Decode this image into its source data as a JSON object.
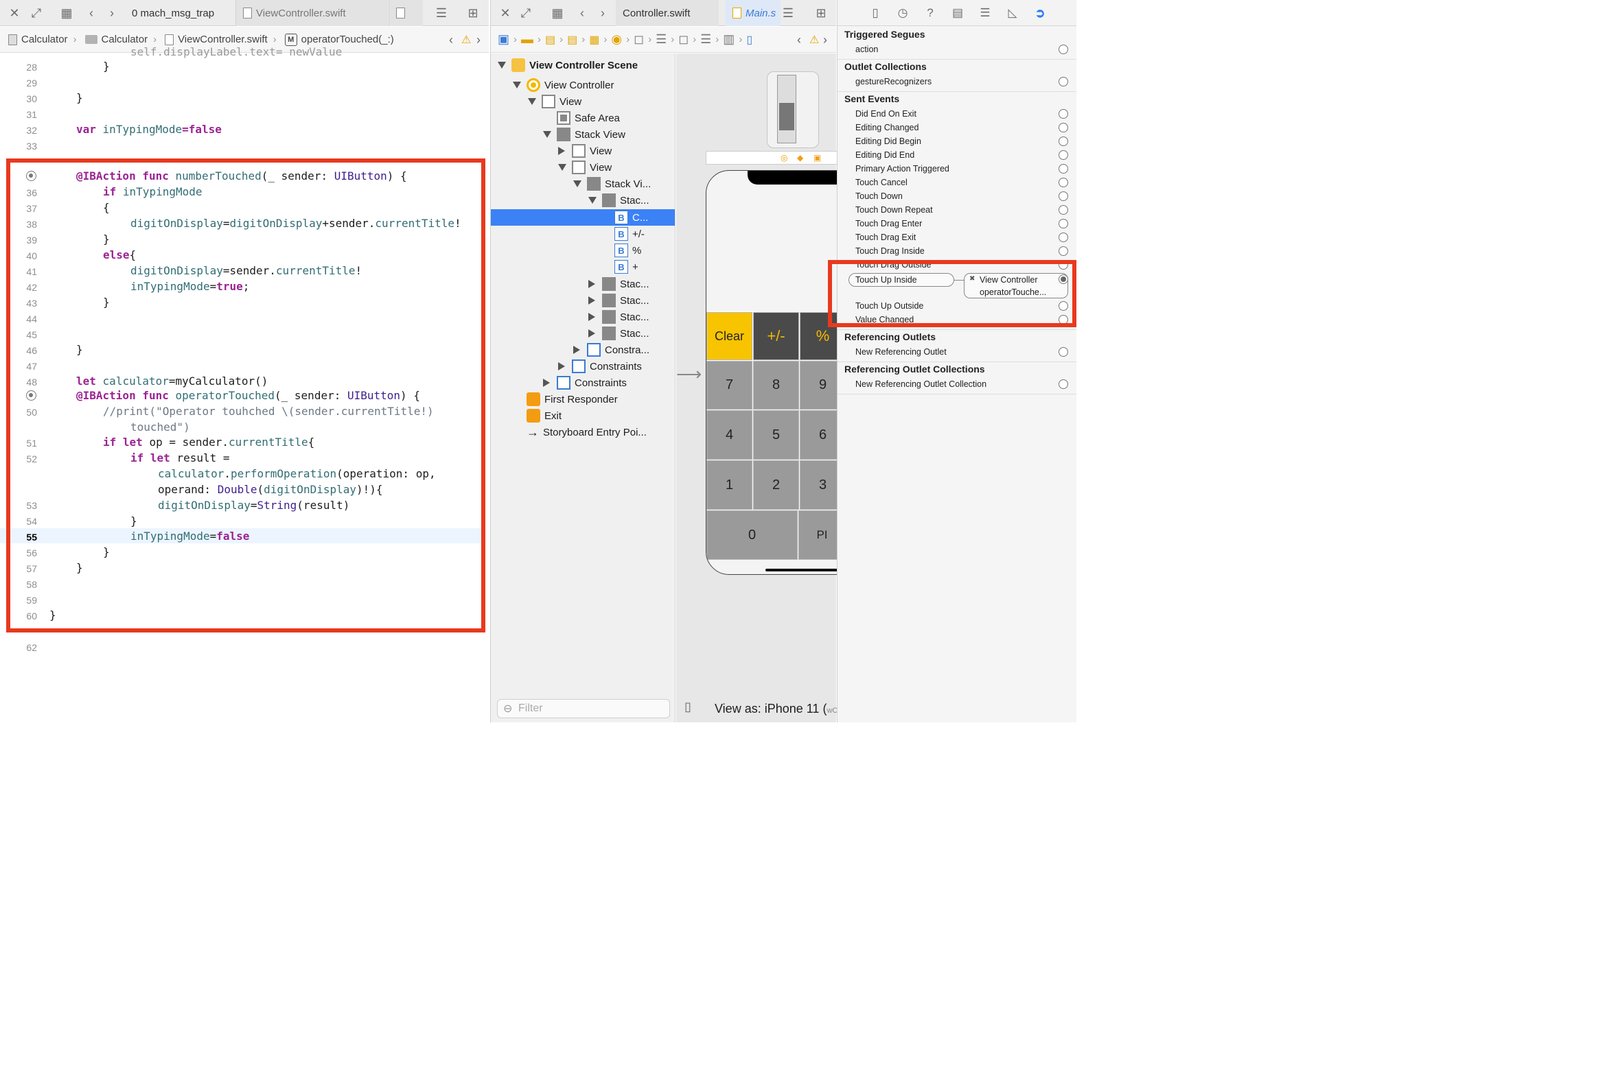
{
  "left_editor": {
    "tabs": {
      "active": "0 mach_msg_trap",
      "inactive": "ViewController.swift"
    },
    "breadcrumb": [
      "Calculator",
      "Calculator",
      "ViewController.swift",
      "operatorTouched(_:)"
    ],
    "mbadge": "M",
    "current_line": "55",
    "lines": [
      {
        "n": "28"
      },
      {
        "n": "29"
      },
      {
        "n": "30"
      },
      {
        "n": "31"
      },
      {
        "n": "32"
      },
      {
        "n": "33"
      },
      {
        "n": "36"
      },
      {
        "n": "37"
      },
      {
        "n": "38"
      },
      {
        "n": "39"
      },
      {
        "n": "40"
      },
      {
        "n": "41"
      },
      {
        "n": "42"
      },
      {
        "n": "43"
      },
      {
        "n": "44"
      },
      {
        "n": "45"
      },
      {
        "n": "46"
      },
      {
        "n": "47"
      },
      {
        "n": "48"
      },
      {
        "n": "50"
      },
      {
        "n": "51"
      },
      {
        "n": "52"
      },
      {
        "n": "53"
      },
      {
        "n": "54"
      },
      {
        "n": "56"
      },
      {
        "n": "57"
      },
      {
        "n": "58"
      },
      {
        "n": "59"
      },
      {
        "n": "60"
      },
      {
        "n": "62"
      }
    ],
    "code": {
      "l27": "self.displayLabel.text= newValue",
      "c_close_brace": "}",
      "c_open_brace": "{",
      "var_kw": "var",
      "var_name": "inTypingMode",
      "eq_false": "=false",
      "iba": "@IBAction",
      "func_kw": "func",
      "fn1": "numberTouched",
      "sig1": "(_ sender: ",
      "uib": "UIButton",
      "sig_end": ") {",
      "if_kw": "if",
      "if_cond": "inTypingMode",
      "digit": "digitOnDisplay",
      "l38_mid": "=",
      "l38_mid2": "+sender.",
      "curTitle": "currentTitle",
      "bang": "!",
      "else_kw": "else",
      "else_brace": "{",
      "l41_mid": "=sender.",
      "l42_tail": "=true;",
      "true_kw": "true",
      "let_kw": "let",
      "calc_name": "calculator",
      "calc_init": "=myCalculator()",
      "fn2": "operatorTouched",
      "comment1": "//print(\"Operator touhched \\(sender.currentTitle!)",
      "comment2": "touched\")",
      "iflet_op": " op = sender.",
      "brace_open": "{",
      "result_eq": " result =",
      "perf": "performOperation",
      "perf_args": "(operation: op,",
      "operand": "operand: ",
      "double": "Double",
      "dparen": "(",
      "dclose": ")!){",
      "string_kw": "String",
      "result_paren": "(result)",
      "false_kw": "false"
    }
  },
  "middle": {
    "tab_title": "Controller.swift",
    "tab_title2": "Main.s",
    "outline": [
      {
        "label": "View Controller Scene"
      },
      {
        "label": "View Controller"
      },
      {
        "label": "View"
      },
      {
        "label": "Safe Area"
      },
      {
        "label": "Stack View"
      },
      {
        "label": "View"
      },
      {
        "label": "View"
      },
      {
        "label": "Stack Vi..."
      },
      {
        "label": "Stac..."
      },
      {
        "label": "C..."
      },
      {
        "label": "+/-"
      },
      {
        "label": "%"
      },
      {
        "label": "+"
      },
      {
        "label": "Stac..."
      },
      {
        "label": "Stac..."
      },
      {
        "label": "Stac..."
      },
      {
        "label": "Stac..."
      },
      {
        "label": "Constra..."
      },
      {
        "label": "Constraints"
      },
      {
        "label": "Constraints"
      },
      {
        "label": "First Responder"
      },
      {
        "label": "Exit"
      },
      {
        "label": "Storyboard Entry Poi..."
      }
    ],
    "button_badge": "B",
    "filter_placeholder": "Filter",
    "view_as": "View as: iPhone 11 (",
    "view_as_tail": "wC",
    "keys": [
      "Clear",
      "+/-",
      "%",
      "7",
      "8",
      "9",
      "4",
      "5",
      "6",
      "1",
      "2",
      "3",
      "0",
      "PI"
    ]
  },
  "inspector": {
    "sections": {
      "triggered_segues": "Triggered Segues",
      "outlet_collections": "Outlet Collections",
      "sent_events": "Sent Events",
      "referencing_outlets": "Referencing Outlets",
      "referencing_outlet_collections": "Referencing Outlet Collections"
    },
    "action": "action",
    "gesture": "gestureRecognizers",
    "events": [
      "Did End On Exit",
      "Editing Changed",
      "Editing Did Begin",
      "Editing Did End",
      "Primary Action Triggered",
      "Touch Cancel",
      "Touch Down",
      "Touch Down Repeat",
      "Touch Drag Enter",
      "Touch Drag Exit",
      "Touch Drag Inside",
      "Touch Drag Outside"
    ],
    "touch_up_inside": "Touch Up Inside",
    "conn_target": "View Controller",
    "conn_method": "operatorTouche...",
    "conn_x": "✖",
    "touch_up_outside": "Touch Up Outside",
    "value_changed": "Value Changed",
    "new_ref_outlet": "New Referencing Outlet",
    "new_ref_outlet_coll": "New Referencing Outlet Collection"
  },
  "colors": {
    "highlight_red": "#e8391e",
    "selection_blue": "#3b82f6",
    "calc_yellow": "#f8c400"
  }
}
